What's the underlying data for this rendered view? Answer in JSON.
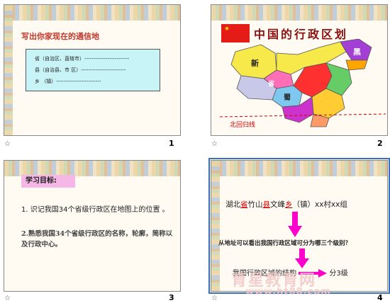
{
  "slides": [
    {
      "number": "1",
      "title": "写出你家现在的通信地",
      "address_lines": [
        "省（自治区、直辖市）-------------------------",
        "县（自治县、市  区）-------------------------",
        "乡              （镇）-------------------------"
      ]
    },
    {
      "number": "2",
      "title": "中国的行政区划",
      "map_labels": [
        "新",
        "黑",
        "省",
        "蜀",
        "北回归线"
      ]
    },
    {
      "number": "3",
      "goal_label": "学习目标:",
      "goal_1": "1. 识记我国34个省级行政区在地图上的位置    。",
      "goal_2": "2.熟悉我国34个省级行政区的名称，轮廓，简称以及行政中心。"
    },
    {
      "number": "4",
      "address_parts": [
        "湖北",
        "省",
        "竹山",
        "县",
        "文峰",
        "乡",
        "（镇）xx村xx组"
      ],
      "question": "从地址可以看出我国行政区域可分为哪三个级别？",
      "structure_left": "我国行政区域的结构",
      "structure_right": "分3级"
    }
  ],
  "star_symbol": "☆",
  "ellipsis": "…",
  "watermark_text": "育星教育网",
  "watermark_url": "www.ht88.com",
  "colors": {
    "title_red": "#c0392b",
    "map_red": "#d10000",
    "arrow_magenta": "#ff00cc"
  }
}
